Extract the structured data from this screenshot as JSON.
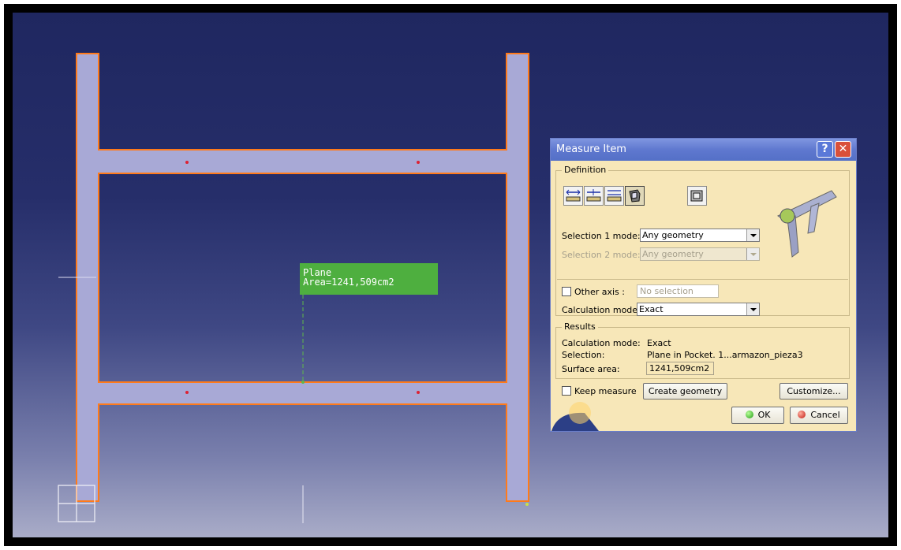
{
  "annotation": {
    "line1": "Plane",
    "line2": "Area=1241,509cm2"
  },
  "dialog": {
    "title": "Measure Item",
    "help_label": "?",
    "close_label": "✕",
    "definition": {
      "legend": "Definition",
      "selection1_label": "Selection 1 mode:",
      "selection1_value": "Any geometry",
      "selection2_label": "Selection 2 mode:",
      "selection2_value": "Any geometry",
      "other_axis_label": "Other axis :",
      "other_axis_placeholder": "No selection",
      "calc_mode_label": "Calculation mode:",
      "calc_mode_value": "Exact"
    },
    "results": {
      "legend": "Results",
      "rows": [
        {
          "label": "Calculation mode:",
          "value": "Exact"
        },
        {
          "label": "Selection:",
          "value": "Plane in Pocket. 1...armazon_pieza3"
        },
        {
          "label": "Surface area:",
          "value": "1241,509cm2"
        }
      ]
    },
    "keep_measure_label": "Keep measure",
    "create_geometry_label": "Create geometry",
    "customize_label": "Customize...",
    "ok_label": "OK",
    "cancel_label": "Cancel"
  },
  "colors": {
    "annotation": "#4eaf3f",
    "part_fill": "#a8a9d6",
    "part_edge": "#ff7a1a",
    "titlebar": "#5f78cf"
  },
  "icons": [
    "measure-between-icon",
    "measure-between-chain-icon",
    "measure-between-fan-icon",
    "measure-item-icon",
    "measure-thickness-icon",
    "caliper-icon",
    "compass-icon"
  ]
}
